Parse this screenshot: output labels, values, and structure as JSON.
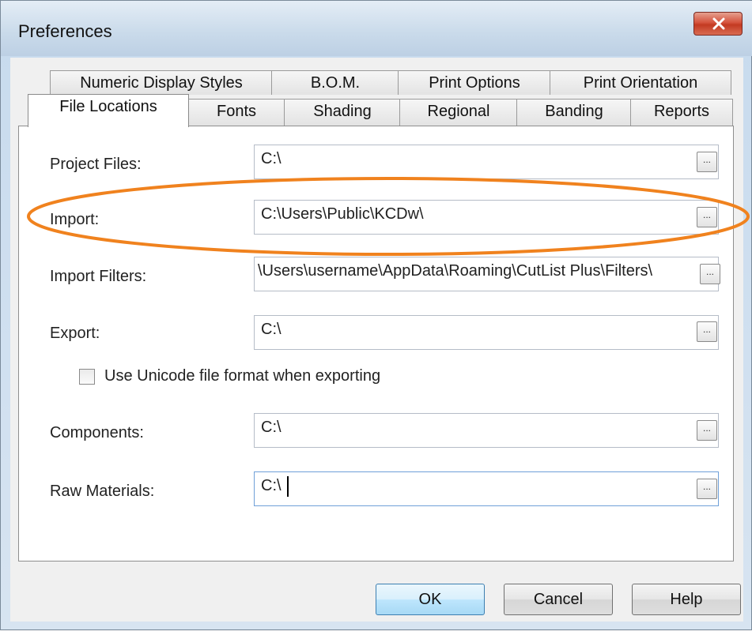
{
  "window": {
    "title": "Preferences"
  },
  "tabs": {
    "row_back": [
      "Numeric Display Styles",
      "B.O.M.",
      "Print Options",
      "Print Orientation"
    ],
    "row_front": [
      "File Locations",
      "Fonts",
      "Shading",
      "Regional",
      "Banding",
      "Reports"
    ],
    "active": "File Locations"
  },
  "fields": [
    {
      "label": "Project Files:",
      "value": "C:\\"
    },
    {
      "label": "Import:",
      "value": "C:\\Users\\Public\\KCDw\\"
    },
    {
      "label": "Import Filters:",
      "value": "\\Users\\username\\AppData\\Roaming\\CutList Plus\\Filters\\"
    },
    {
      "label": "Export:",
      "value": "C:\\"
    },
    {
      "label": "Components:",
      "value": "C:\\"
    },
    {
      "label": "Raw Materials:",
      "value": "C:\\"
    }
  ],
  "browse_label": "...",
  "unicode_checkbox": {
    "label": "Use Unicode file format when exporting",
    "checked": false
  },
  "buttons": {
    "ok": "OK",
    "cancel": "Cancel",
    "help": "Help"
  },
  "annotation": {
    "highlight_color": "#f0821e"
  },
  "colors": {
    "close_button": "#c9452c",
    "default_button": "#3c7fb1"
  }
}
